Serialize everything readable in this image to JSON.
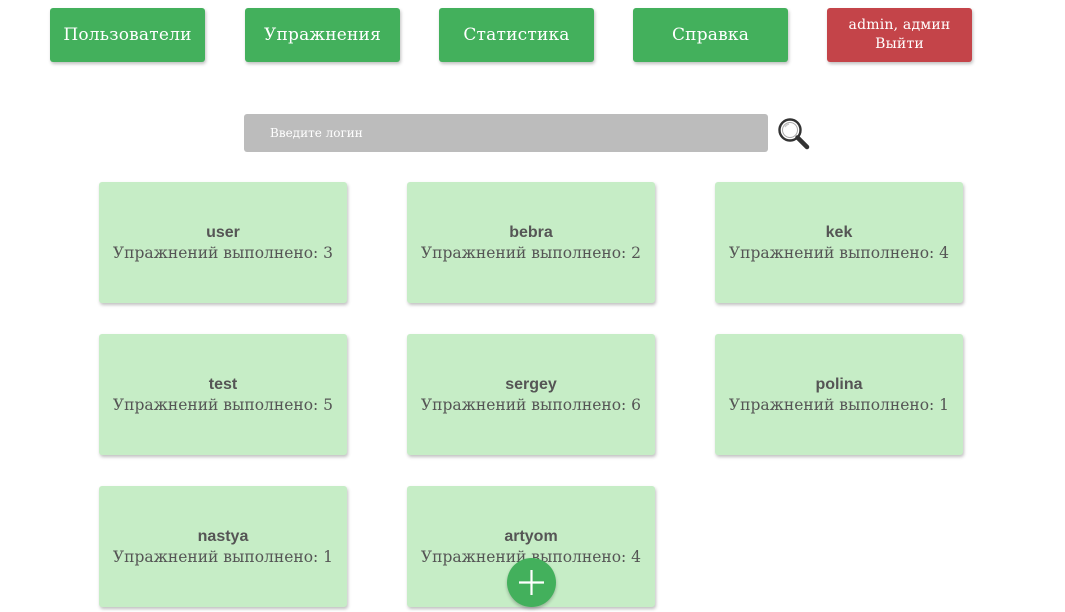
{
  "nav": {
    "users_label": "Пользователи",
    "exercises_label": "Упражнения",
    "statistics_label": "Статистика",
    "help_label": "Справка",
    "user_label": "admin, админ",
    "logout_label": "Выйти"
  },
  "search": {
    "placeholder": "Введите логин",
    "value": ""
  },
  "users": [
    {
      "name": "user",
      "count_text": "Упражнений выполнено: 3"
    },
    {
      "name": "bebra",
      "count_text": "Упражнений выполнено: 2"
    },
    {
      "name": "kek",
      "count_text": "Упражнений выполнено: 4"
    },
    {
      "name": "test",
      "count_text": "Упражнений выполнено: 5"
    },
    {
      "name": "sergey",
      "count_text": "Упражнений выполнено: 6"
    },
    {
      "name": "polina",
      "count_text": "Упражнений выполнено: 1"
    },
    {
      "name": "nastya",
      "count_text": "Упражнений выполнено: 1"
    },
    {
      "name": "artyom",
      "count_text": "Упражнений выполнено: 4"
    }
  ],
  "colors": {
    "primary_green": "#43b05c",
    "danger_red": "#c44449",
    "card_bg": "#c6edc6",
    "search_bg": "#bcbcbc"
  },
  "icons": {
    "search": "search-icon",
    "add": "plus-icon"
  }
}
